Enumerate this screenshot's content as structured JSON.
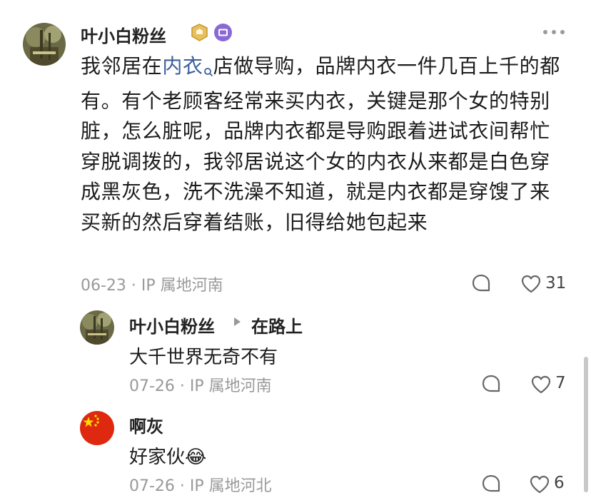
{
  "comment": {
    "author": "叶小白粉丝",
    "text_before_link": "我邻居在",
    "link_text": "内衣",
    "text_after_link": "店做导购，品牌内衣一件几百上千的都有。有个老顾客经常来买内衣，关键是那个女的特别脏，怎么脏呢，品牌内衣都是导购跟着进试衣间帮忙穿脱调拨的，我邻居说这个女的内衣从来都是白色穿成黑灰色，洗不洗澡不知道，就是内衣都是穿馊了来买新的然后穿着结账，旧得给她包起来",
    "date": "06-23",
    "ip": "IP 属地河南",
    "likes": "31"
  },
  "replies": [
    {
      "author": "叶小白粉丝",
      "reply_to": "在路上",
      "text": "大千世界无奇不有",
      "date": "07-26",
      "ip": "IP 属地河南",
      "likes": "7"
    },
    {
      "author": "啊灰",
      "text": "好家伙",
      "emoji": "😂",
      "date": "07-26",
      "ip": "IP 属地河北",
      "likes": "6"
    }
  ],
  "icons": {
    "more": "more-dots-icon",
    "comment": "comment-bubble-icon",
    "like": "heart-outline-icon",
    "badge1": "gold-shield-badge-icon",
    "badge2": "purple-tv-badge-icon",
    "search": "search-link-icon",
    "arrow": "reply-arrow-icon"
  },
  "colors": {
    "link": "#3a5f9a",
    "meta": "#999999",
    "badge_gold": "#d9a53a",
    "badge_purple": "#7b5cc4"
  }
}
